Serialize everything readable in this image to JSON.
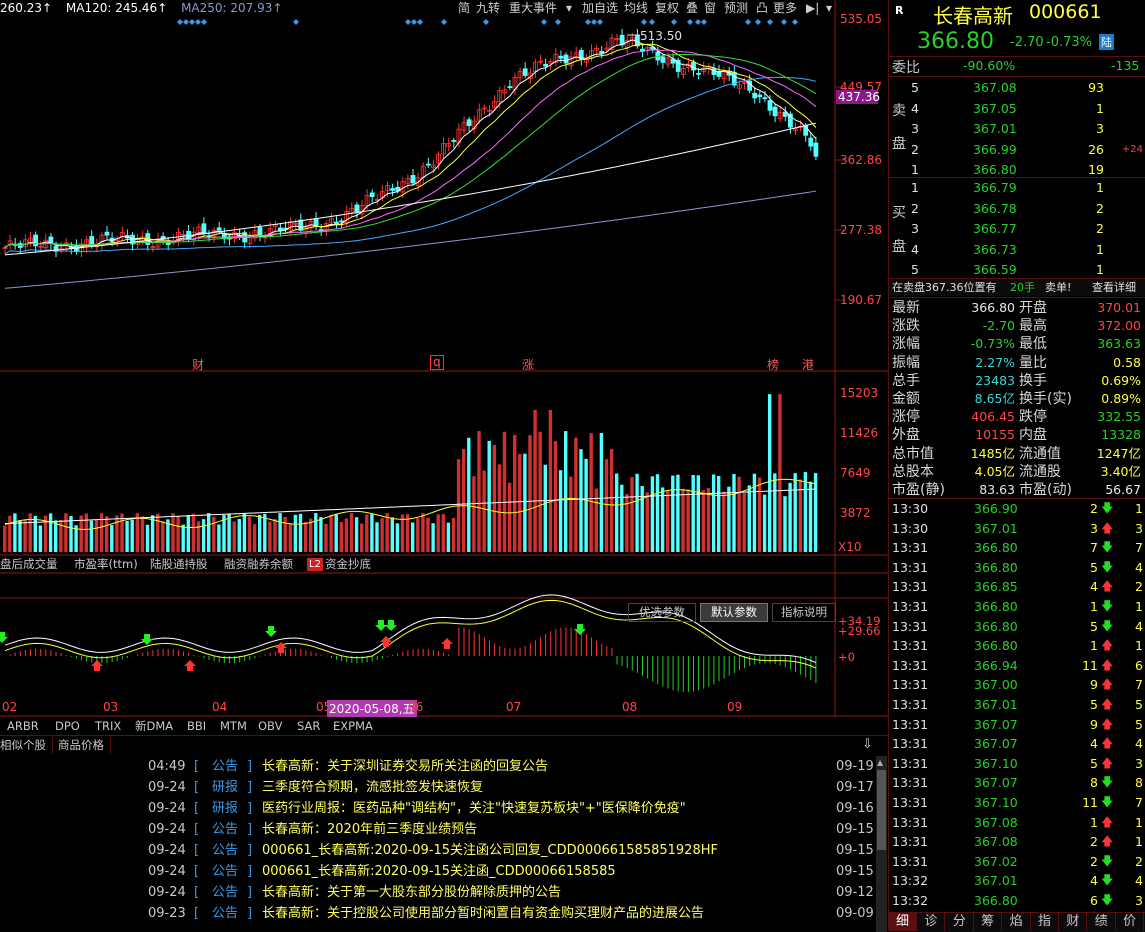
{
  "ma_bar": [
    {
      "text": "260.23↑",
      "color": "#ffffff"
    },
    {
      "text": "MA120: 245.46↑",
      "color": "#ffffff"
    },
    {
      "text": "MA250: 207.93↑",
      "color": "#8899cc"
    }
  ],
  "toolbar": [
    "简",
    "九转",
    "重大事件",
    "▾",
    "加自选",
    "均线",
    "复权",
    "叠",
    "窗",
    "预测",
    "凸",
    "更多",
    "▶|",
    "▾"
  ],
  "main_axis": [
    "535.05",
    "449.57",
    "437.36",
    "362.86",
    "277.38",
    "190.67"
  ],
  "peak_label": "513.50",
  "event_markers": [
    "财",
    "q",
    "涨",
    "榜",
    "港"
  ],
  "vol_axis": [
    "15203",
    "11426",
    "7649",
    "3872",
    "X10"
  ],
  "vol_tabs": [
    "盘后成交量",
    "市盈率(ttm)",
    "陆股通持股",
    "融资融券余额",
    "L2",
    "资金抄底"
  ],
  "macd_buttons": [
    "优选参数",
    "默认参数",
    "指标说明"
  ],
  "macd_axis": [
    "+34.19",
    "+29.66",
    "+0"
  ],
  "date_axis": [
    "02",
    "03",
    "04",
    "05",
    "2020-05-08,五",
    "06",
    "07",
    "08",
    "09"
  ],
  "indicator_tabs": [
    "ARBR",
    "DPO",
    "TRIX",
    "新DMA",
    "BBI",
    "MTM",
    "OBV",
    "SAR",
    "EXPMA"
  ],
  "news_tabs": [
    "相似个股",
    "商品价格"
  ],
  "news": [
    {
      "t": "04:49",
      "tag": "公告",
      "title": "长春高新：关于深圳证券交易所关注函的回复公告",
      "d": "09-19"
    },
    {
      "t": "09-24",
      "tag": "研报",
      "title": "三季度符合预期，流感批签发快速恢复",
      "d": "09-17"
    },
    {
      "t": "09-24",
      "tag": "研报",
      "title": "医药行业周报：医药品种\"调结构\"，关注\"快速复苏板块\"+\"医保降价免疫\"",
      "d": "09-16"
    },
    {
      "t": "09-24",
      "tag": "公告",
      "title": "长春高新：2020年前三季度业绩预告",
      "d": "09-15"
    },
    {
      "t": "09-24",
      "tag": "公告",
      "title": "000661_长春高新:2020-09-15关注函公司回复_CDD000661585851928HF",
      "d": "09-15"
    },
    {
      "t": "09-24",
      "tag": "公告",
      "title": "000661_长春高新:2020-09-15关注函_CDD00066158585",
      "d": "09-15"
    },
    {
      "t": "09-24",
      "tag": "公告",
      "title": "长春高新：关于第一大股东部分股份解除质押的公告",
      "d": "09-12"
    },
    {
      "t": "09-23",
      "tag": "公告",
      "title": "长春高新：关于控股公司使用部分暂时闲置自有资金购买理财产品的进展公告",
      "d": "09-09"
    }
  ],
  "quote": {
    "r_icon": "R",
    "name": "长春高新",
    "code": "000661",
    "price": "366.80",
    "change": "-2.70",
    "pct": "-0.73%",
    "lu": "陆",
    "weibi_label": "委比",
    "weibi": "-90.60%",
    "weicha": "-135",
    "sell_label": [
      "卖",
      "盘"
    ],
    "buy_label": [
      "买",
      "盘"
    ],
    "sells": [
      {
        "n": "5",
        "p": "367.08",
        "v": "93",
        "x": ""
      },
      {
        "n": "4",
        "p": "367.05",
        "v": "1",
        "x": ""
      },
      {
        "n": "3",
        "p": "367.01",
        "v": "3",
        "x": ""
      },
      {
        "n": "2",
        "p": "366.99",
        "v": "26",
        "x": "+24"
      },
      {
        "n": "1",
        "p": "366.80",
        "v": "19",
        "x": ""
      }
    ],
    "buys": [
      {
        "n": "1",
        "p": "366.79",
        "v": "1"
      },
      {
        "n": "2",
        "p": "366.78",
        "v": "2"
      },
      {
        "n": "3",
        "p": "366.77",
        "v": "2"
      },
      {
        "n": "4",
        "p": "366.73",
        "v": "1"
      },
      {
        "n": "5",
        "p": "366.59",
        "v": "1"
      }
    ],
    "banner": {
      "text": "在卖盘367.36位置有",
      "hands": "20手",
      "kind": "卖单!",
      "detail": "查看详细"
    },
    "stats": [
      [
        "最新",
        "366.80",
        "white",
        "开盘",
        "370.01",
        "red"
      ],
      [
        "涨跌",
        "-2.70",
        "green",
        "最高",
        "372.00",
        "red"
      ],
      [
        "涨幅",
        "-0.73%",
        "green",
        "最低",
        "363.63",
        "green"
      ],
      [
        "振幅",
        "2.27%",
        "cyan",
        "量比",
        "0.58",
        "yellow"
      ],
      [
        "总手",
        "23483",
        "cyan",
        "换手",
        "0.69%",
        "yellow"
      ],
      [
        "金额",
        "8.65亿",
        "cyan",
        "换手(实)",
        "0.89%",
        "yellow"
      ],
      [
        "涨停",
        "406.45",
        "red",
        "跌停",
        "332.55",
        "green"
      ],
      [
        "外盘",
        "10155",
        "red",
        "内盘",
        "13328",
        "green"
      ],
      [
        "总市值",
        "1485亿",
        "yellow",
        "流通值",
        "1247亿",
        "yellow"
      ],
      [
        "总股本",
        "4.05亿",
        "yellow",
        "流通股",
        "3.40亿",
        "yellow"
      ],
      [
        "市盈(静)",
        "83.63",
        "white",
        "市盈(动)",
        "56.67",
        "white"
      ]
    ]
  },
  "ticks": [
    [
      "13:30",
      "366.90",
      "2",
      "down",
      "1"
    ],
    [
      "13:30",
      "367.01",
      "3",
      "up",
      "3"
    ],
    [
      "13:31",
      "366.80",
      "7",
      "down",
      "7"
    ],
    [
      "13:31",
      "366.80",
      "5",
      "down",
      "4"
    ],
    [
      "13:31",
      "366.85",
      "4",
      "up",
      "2"
    ],
    [
      "13:31",
      "366.80",
      "1",
      "down",
      "1"
    ],
    [
      "13:31",
      "366.80",
      "5",
      "down",
      "4"
    ],
    [
      "13:31",
      "366.80",
      "1",
      "up",
      "1"
    ],
    [
      "13:31",
      "366.94",
      "11",
      "up",
      "6"
    ],
    [
      "13:31",
      "367.00",
      "9",
      "up",
      "7"
    ],
    [
      "13:31",
      "367.01",
      "5",
      "up",
      "5"
    ],
    [
      "13:31",
      "367.07",
      "9",
      "up",
      "5"
    ],
    [
      "13:31",
      "367.07",
      "4",
      "up",
      "4"
    ],
    [
      "13:31",
      "367.10",
      "5",
      "up",
      "3"
    ],
    [
      "13:31",
      "367.07",
      "8",
      "down",
      "8"
    ],
    [
      "13:31",
      "367.10",
      "11",
      "down",
      "7"
    ],
    [
      "13:31",
      "367.08",
      "1",
      "up",
      "1"
    ],
    [
      "13:31",
      "367.08",
      "2",
      "up",
      "1"
    ],
    [
      "13:31",
      "367.02",
      "2",
      "down",
      "2"
    ],
    [
      "13:32",
      "367.01",
      "4",
      "down",
      "4"
    ],
    [
      "13:32",
      "366.80",
      "6",
      "down",
      "3"
    ]
  ],
  "bottom_tabs": [
    "细",
    "诊",
    "分",
    "筹",
    "焰",
    "指",
    "财",
    "绩",
    "价"
  ],
  "colors": {
    "up": "#ff3333",
    "down": "#54ffff",
    "ma_white": "#ffffff",
    "ma_yellow": "#ffff33",
    "ma_pink": "#ff66ff",
    "ma_green": "#33dd33",
    "ma_blue": "#44aaff",
    "ma_gray": "#8899cc"
  },
  "chart_data": {
    "type": "candlestick",
    "price_axis": [
      535.05,
      449.57,
      362.86,
      277.38,
      190.67
    ],
    "months": [
      "02",
      "03",
      "04",
      "05",
      "06",
      "07",
      "08",
      "09"
    ],
    "peak": 513.5,
    "last_close": 366.8
  }
}
